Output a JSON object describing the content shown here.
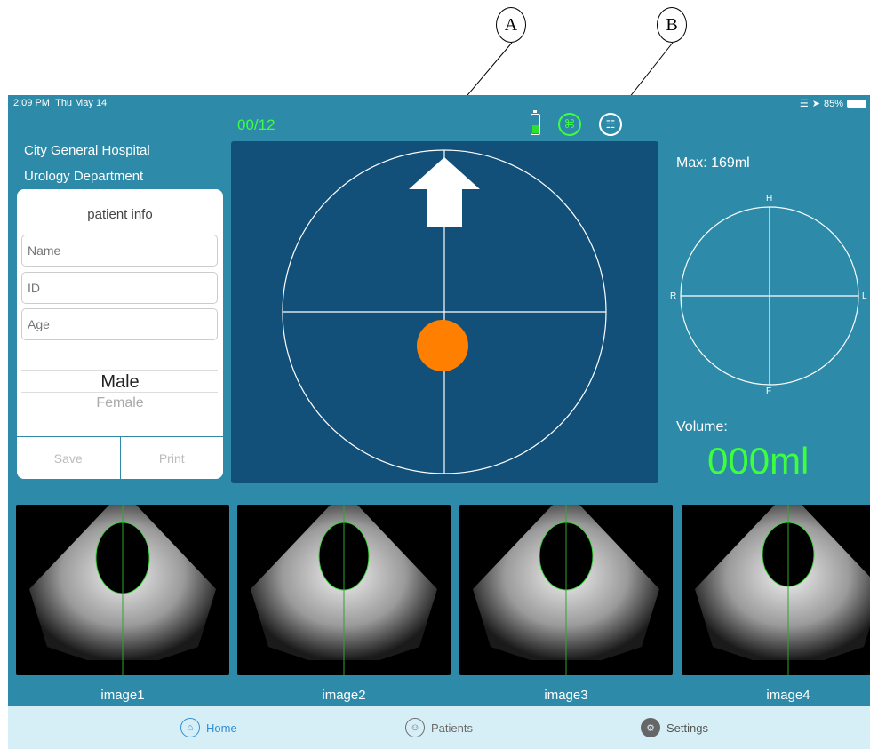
{
  "callouts": {
    "a": "A",
    "b": "B"
  },
  "status_bar": {
    "time": "2:09 PM",
    "day": "Thu May 14",
    "battery": "85%"
  },
  "header": {
    "counter": "00/12"
  },
  "hospital": {
    "name": "City General Hospital",
    "department": "Urology Department"
  },
  "patient_info": {
    "title": "patient info",
    "name_placeholder": "Name",
    "id_placeholder": "ID",
    "age_placeholder": "Age",
    "gender_options": [
      "Male",
      "Female"
    ],
    "save_label": "Save",
    "print_label": "Print"
  },
  "measurements": {
    "max_label": "Max: 169ml",
    "volume_label": "Volume:",
    "volume_value": "000ml"
  },
  "orientation": {
    "top": "H",
    "left": "R",
    "right": "L",
    "bottom": "F"
  },
  "images": [
    {
      "label": "image1"
    },
    {
      "label": "image2"
    },
    {
      "label": "image3"
    },
    {
      "label": "image4"
    }
  ],
  "tabs": [
    {
      "label": "Home",
      "icon": "home-icon",
      "active": true
    },
    {
      "label": "Patients",
      "icon": "patients-icon",
      "active": false
    },
    {
      "label": "Settings",
      "icon": "gear-icon",
      "active": false
    }
  ],
  "colors": {
    "screen_bg": "#2d8aa8",
    "viewer_bg": "#12507a",
    "accent_green": "#3dff3d",
    "target_dot": "#ff8000",
    "tab_active": "#2f8fd6",
    "tab_inactive": "#6b6b6b"
  }
}
